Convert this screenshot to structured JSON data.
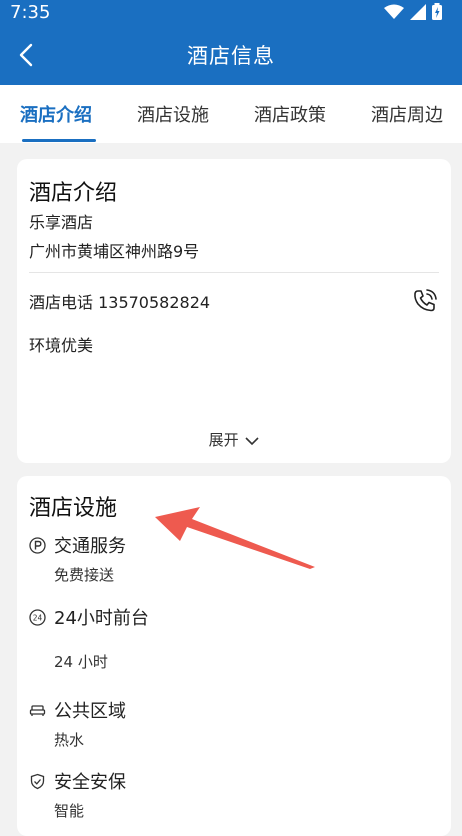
{
  "status_bar": {
    "time": "7:35"
  },
  "header": {
    "title": "酒店信息"
  },
  "tabs": [
    {
      "label": "酒店介绍",
      "active": true
    },
    {
      "label": "酒店设施",
      "active": false
    },
    {
      "label": "酒店政策",
      "active": false
    },
    {
      "label": "酒店周边",
      "active": false
    }
  ],
  "intro": {
    "title": "酒店介绍",
    "hotel_name": "乐享酒店",
    "address": "广州市黄埔区神州路9号",
    "phone_text": "酒店电话 13570582824",
    "description": "环境优美",
    "expand_label": "展开"
  },
  "facilities": {
    "title": "酒店设施",
    "items": [
      {
        "icon": "parking-icon",
        "title": "交通服务",
        "value": "免费接送"
      },
      {
        "icon": "24h-icon",
        "title": "24小时前台",
        "value": "24 小时"
      },
      {
        "icon": "sofa-icon",
        "title": "公共区域",
        "value": "热水"
      },
      {
        "icon": "shield-icon",
        "title": "安全安保",
        "value": "智能"
      }
    ]
  },
  "colors": {
    "primary": "#1a6fc1",
    "annotation": "#ee5a4f"
  }
}
